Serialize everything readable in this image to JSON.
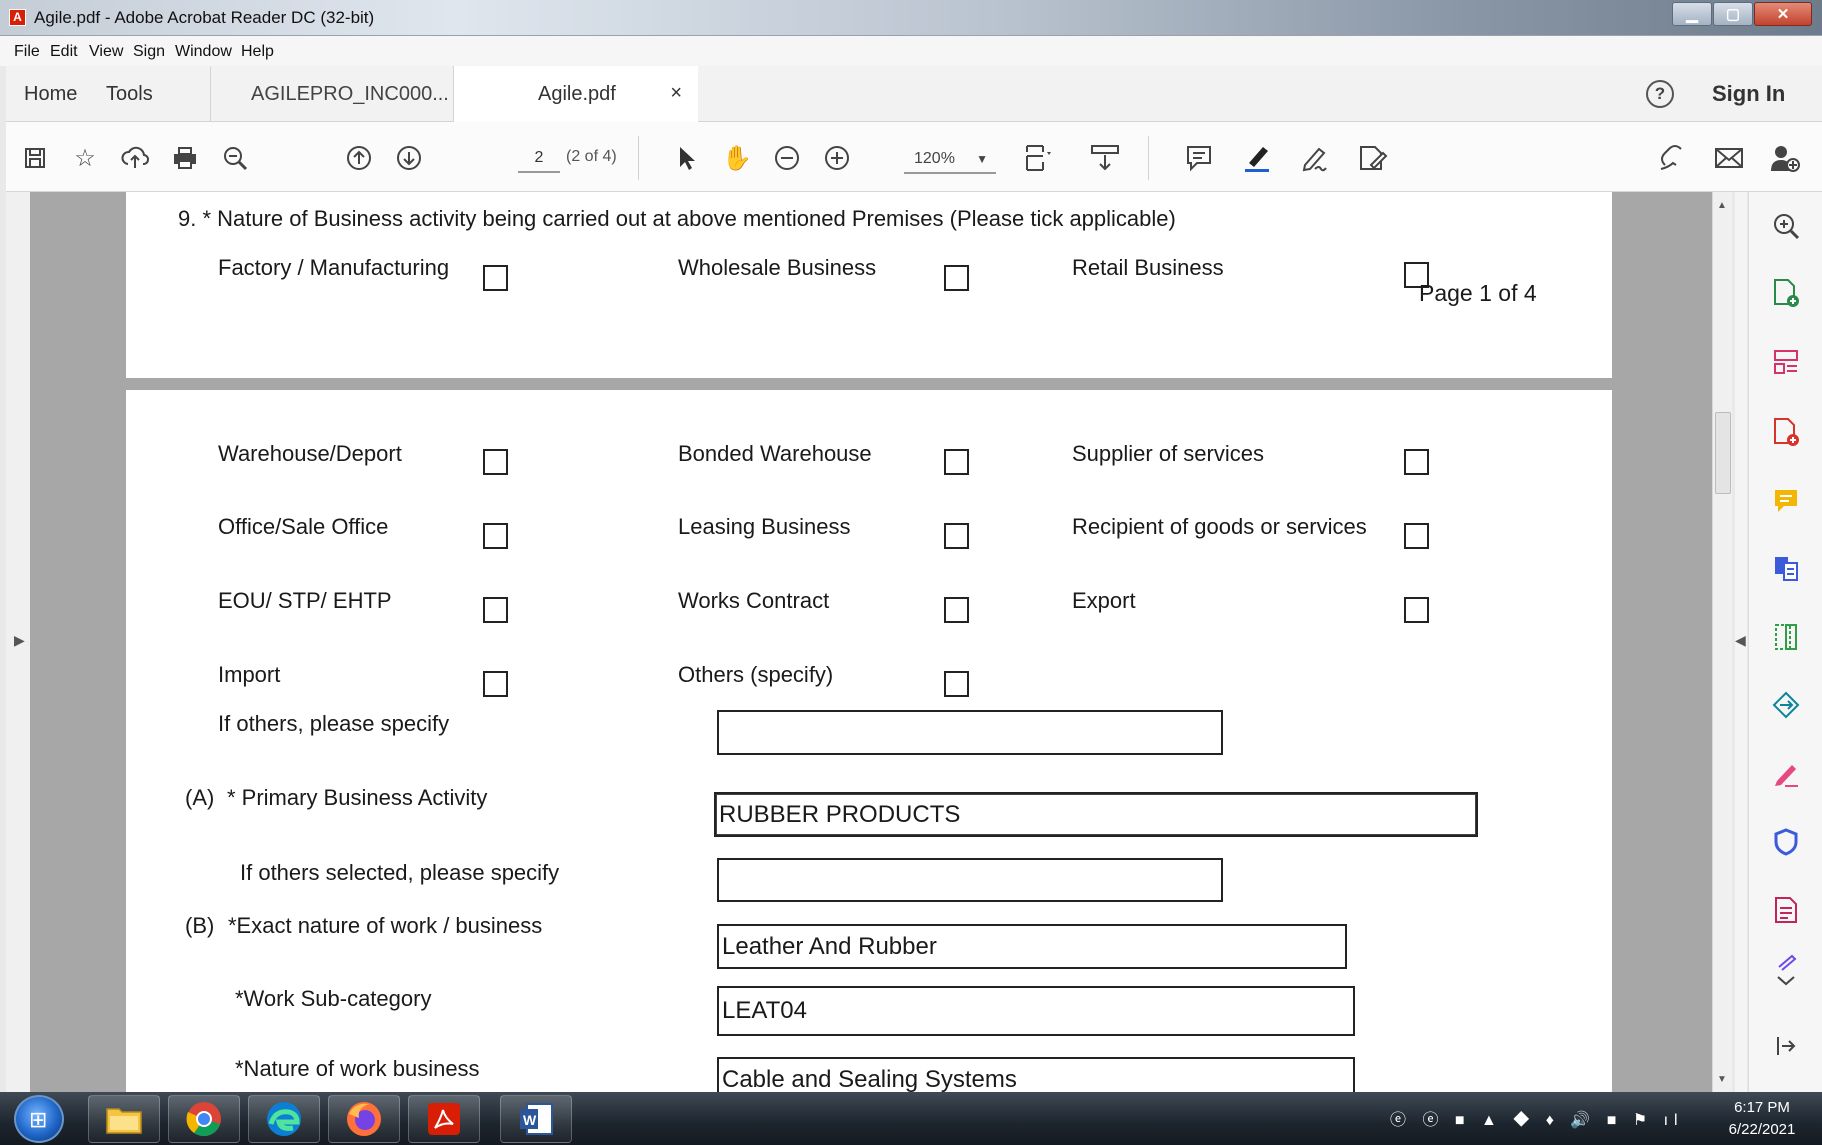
{
  "window": {
    "title": "Agile.pdf - Adobe Acrobat Reader DC (32-bit)",
    "app_icon": "acrobat-icon",
    "controls": [
      "minimize",
      "maximize",
      "close"
    ]
  },
  "menu": [
    "File",
    "Edit",
    "View",
    "Sign",
    "Window",
    "Help"
  ],
  "tabs": {
    "home": "Home",
    "tools": "Tools",
    "doc1": "AGILEPRO_INC000...",
    "doc2": "Agile.pdf",
    "close": "×",
    "sign_in": "Sign In",
    "help": "?"
  },
  "toolbar": {
    "page_number": "2",
    "page_count": "(2 of 4)",
    "zoom": "120%",
    "icons": [
      "save-icon",
      "bookmark-star-icon",
      "upload-cloud-icon",
      "print-icon",
      "search-zoom-icon",
      "page-up-icon",
      "page-down-icon",
      "select-cursor-icon",
      "hand-pan-icon",
      "zoom-out-icon",
      "zoom-in-icon",
      "fit-page-icon",
      "scroll-mode-icon",
      "comment-icon",
      "highlight-pen-icon",
      "sign-icon",
      "fill-sign-icon",
      "share-link-icon",
      "email-icon",
      "add-user-icon"
    ]
  },
  "page1": {
    "question": "9.  * Nature of Business activity being carried out at above mentioned Premises (Please tick applicable)",
    "row1": [
      "Factory / Manufacturing",
      "Wholesale Business",
      "Retail Business"
    ],
    "footer": "Page 1 of 4"
  },
  "page2": {
    "rows": [
      [
        "Warehouse/Deport",
        "Bonded Warehouse",
        "Supplier of services"
      ],
      [
        "Office/Sale Office",
        "Leasing Business",
        "Recipient of goods or services"
      ],
      [
        "EOU/ STP/ EHTP",
        "Works Contract",
        "Export"
      ],
      [
        "Import",
        "Others (specify)"
      ]
    ],
    "if_others_label": "If others, please specify",
    "if_others_value": "",
    "primary_prefix": "(A)",
    "primary_label": "* Primary Business Activity",
    "primary_value": "RUBBER PRODUCTS",
    "others_selected_label": "If others selected, please specify",
    "others_selected_value": "",
    "exact_prefix": "(B)",
    "exact_label": "*Exact nature of work / business",
    "exact_value": "Leather And Rubber",
    "subcat_label": "*Work Sub-category",
    "subcat_value": "LEAT04",
    "nature_label": "*Nature of work business",
    "nature_value": "Cable and Sealing Systems"
  },
  "taskbar": {
    "time": "6:17 PM",
    "date": "6/22/2021",
    "apps": [
      "windows-start-icon",
      "file-explorer-icon",
      "chrome-icon",
      "edge-icon",
      "firefox-icon",
      "acrobat-icon",
      "word-icon"
    ]
  }
}
